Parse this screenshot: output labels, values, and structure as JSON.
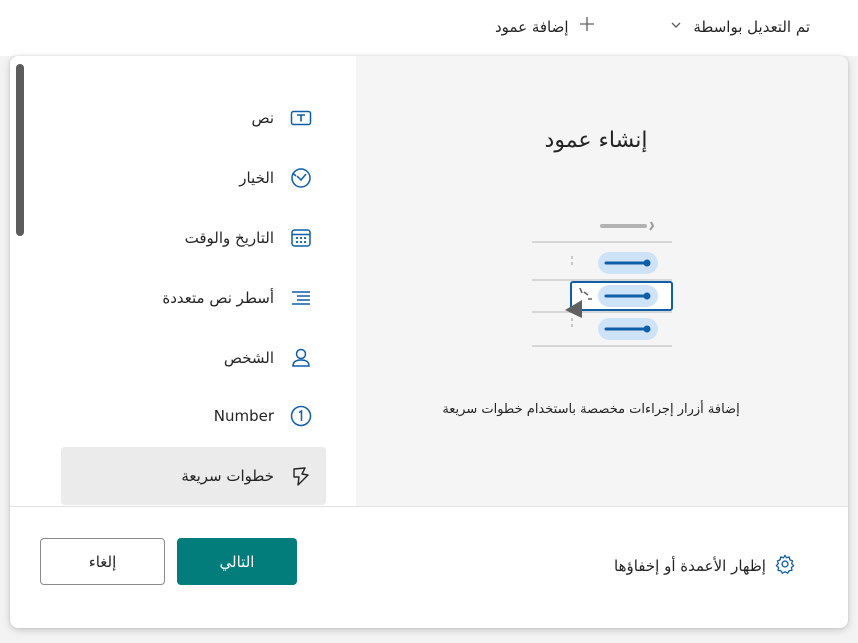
{
  "topbar": {
    "modified_by_label": "تم التعديل بواسطة",
    "add_column_label": "إضافة عمود"
  },
  "dialog": {
    "preview": {
      "title": "إنشاء عمود",
      "description": "إضافة أزرار إجراءات مخصصة باستخدام خطوات سريعة"
    },
    "types": [
      {
        "label": "نص",
        "icon": "text-icon"
      },
      {
        "label": "الخيار",
        "icon": "choice-icon"
      },
      {
        "label": "التاريخ والوقت",
        "icon": "calendar-icon"
      },
      {
        "label": "أسطر نص متعددة",
        "icon": "multiline-text-icon"
      },
      {
        "label": "الشخص",
        "icon": "person-icon"
      },
      {
        "label": "Number",
        "icon": "number-icon"
      },
      {
        "label": "خطوات سريعة",
        "icon": "quick-steps-icon",
        "selected": true
      }
    ],
    "show_hide_columns_label": "إظهار الأعمدة أو إخفاؤها",
    "next_label": "التالي",
    "cancel_label": "إلغاء"
  },
  "colors": {
    "accent": "#037c7c",
    "illustration_blue": "#0f5ea8",
    "illustration_light_blue": "#cfe3f8",
    "selected_item_bg": "#ebebeb"
  }
}
